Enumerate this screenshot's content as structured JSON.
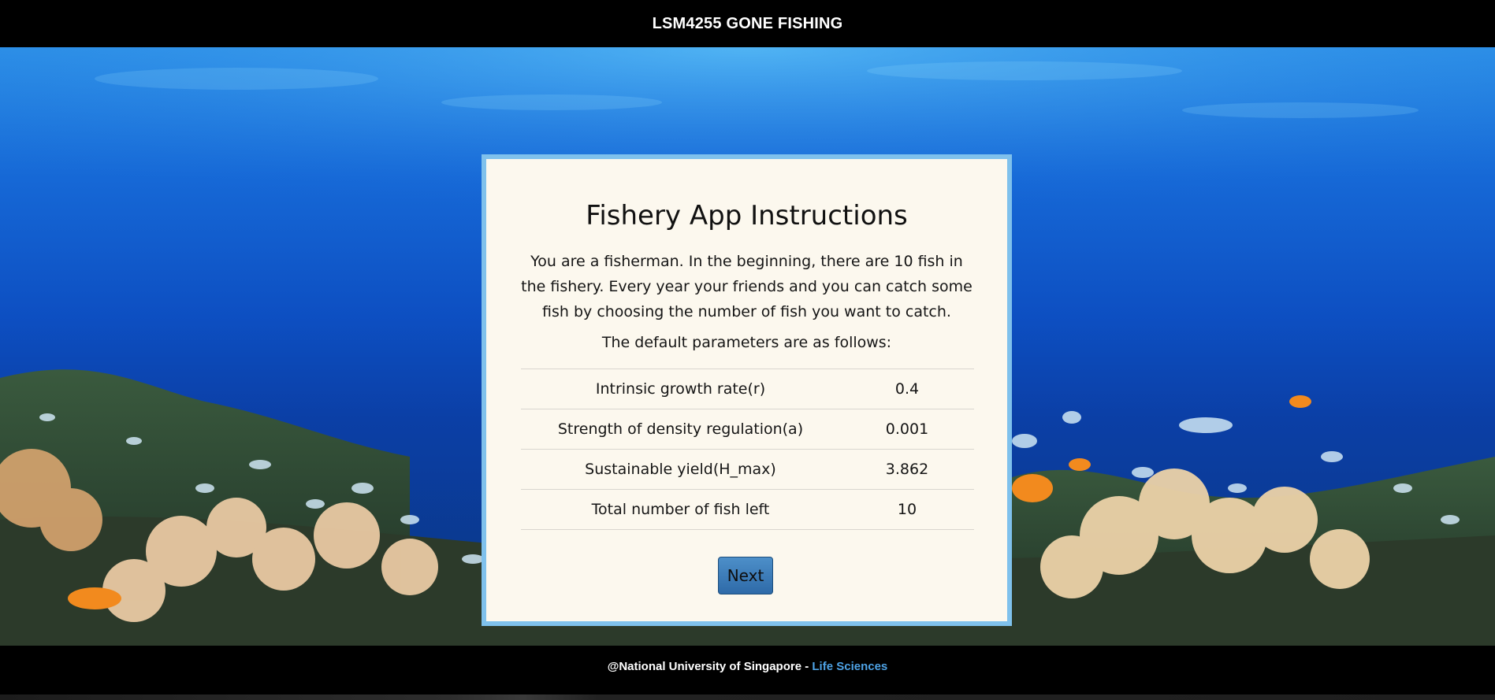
{
  "header": {
    "title": "LSM4255 GONE FISHING"
  },
  "card": {
    "title": "Fishery App Instructions",
    "intro": "You are a fisherman. In the beginning, there are 10 fish in the fishery. Every year your friends and you can catch some fish by choosing the number of fish you want to catch.",
    "params_lead": "The default parameters are as follows:",
    "params": [
      {
        "label": "Intrinsic growth rate(r)",
        "value": "0.4"
      },
      {
        "label": "Strength of density regulation(a)",
        "value": "0.001"
      },
      {
        "label": "Sustainable yield(H_max)",
        "value": "3.862"
      },
      {
        "label": "Total number of fish left",
        "value": "10"
      }
    ],
    "next_label": "Next"
  },
  "footer": {
    "text": "@National University of Singapore - ",
    "link_text": "Life Sciences"
  },
  "colors": {
    "card_bg": "#fcf8ee",
    "card_border": "#7fc1ec",
    "button": "#2e6aa8",
    "link": "#4ea3e6"
  }
}
